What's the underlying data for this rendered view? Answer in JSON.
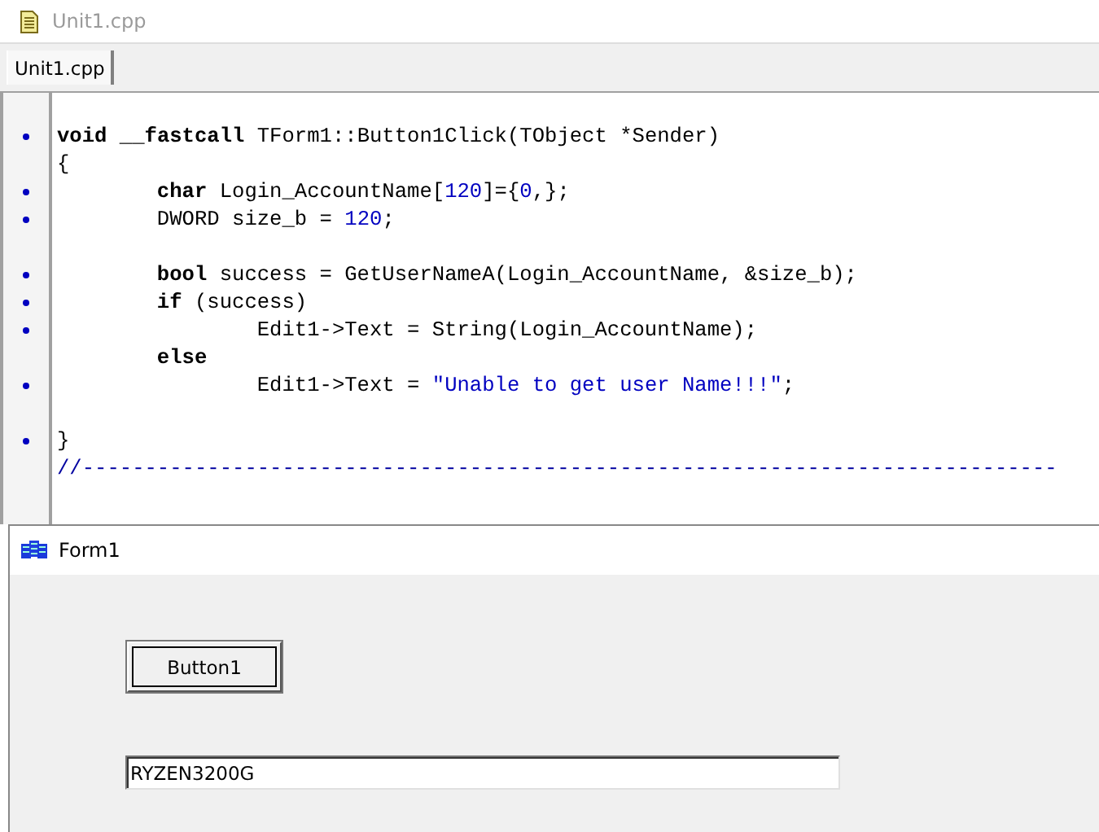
{
  "editor": {
    "title": "Unit1.cpp",
    "tabs": [
      {
        "label": "Unit1.cpp",
        "selected": true
      }
    ],
    "lines": [
      {
        "dot": true,
        "segments": [
          {
            "kind": "kw",
            "text": "void "
          },
          {
            "kind": "kw",
            "text": "__fastcall"
          },
          {
            "kind": "plain",
            "text": " TForm1::Button1Click(TObject *Sender)"
          }
        ]
      },
      {
        "dot": false,
        "segments": [
          {
            "kind": "plain",
            "text": "{"
          }
        ]
      },
      {
        "dot": true,
        "segments": [
          {
            "kind": "kw",
            "text": "        char"
          },
          {
            "kind": "plain",
            "text": " Login_AccountName["
          },
          {
            "kind": "num",
            "text": "120"
          },
          {
            "kind": "plain",
            "text": "]={"
          },
          {
            "kind": "num",
            "text": "0"
          },
          {
            "kind": "plain",
            "text": ",};"
          }
        ]
      },
      {
        "dot": true,
        "segments": [
          {
            "kind": "plain",
            "text": "        DWORD size_b = "
          },
          {
            "kind": "num",
            "text": "120"
          },
          {
            "kind": "plain",
            "text": ";"
          }
        ]
      },
      {
        "dot": false
      },
      {
        "dot": true,
        "segments": [
          {
            "kind": "kw",
            "text": "        bool"
          },
          {
            "kind": "plain",
            "text": " success = GetUserNameA(Login_AccountName, &size_b);"
          }
        ]
      },
      {
        "dot": true,
        "segments": [
          {
            "kind": "kw",
            "text": "        if"
          },
          {
            "kind": "plain",
            "text": " (success)"
          }
        ]
      },
      {
        "dot": true,
        "segments": [
          {
            "kind": "plain",
            "text": "                Edit1->Text = String(Login_AccountName);"
          }
        ]
      },
      {
        "dot": false,
        "segments": [
          {
            "kind": "kw",
            "text": "        else"
          }
        ]
      },
      {
        "dot": true,
        "segments": [
          {
            "kind": "plain",
            "text": "                Edit1->Text = "
          },
          {
            "kind": "str",
            "text": "\"Unable to get user Name!!!\""
          },
          {
            "kind": "plain",
            "text": ";"
          }
        ]
      },
      {
        "dot": false
      },
      {
        "dot": true,
        "segments": [
          {
            "kind": "plain",
            "text": "}"
          }
        ]
      },
      {
        "dot": false,
        "segments": [
          {
            "kind": "cmt",
            "text": "//------------------------------------------------------------------------------"
          }
        ]
      }
    ]
  },
  "form": {
    "title": "Form1",
    "button": "Button1",
    "edit_value": "RYZEN3200G"
  }
}
